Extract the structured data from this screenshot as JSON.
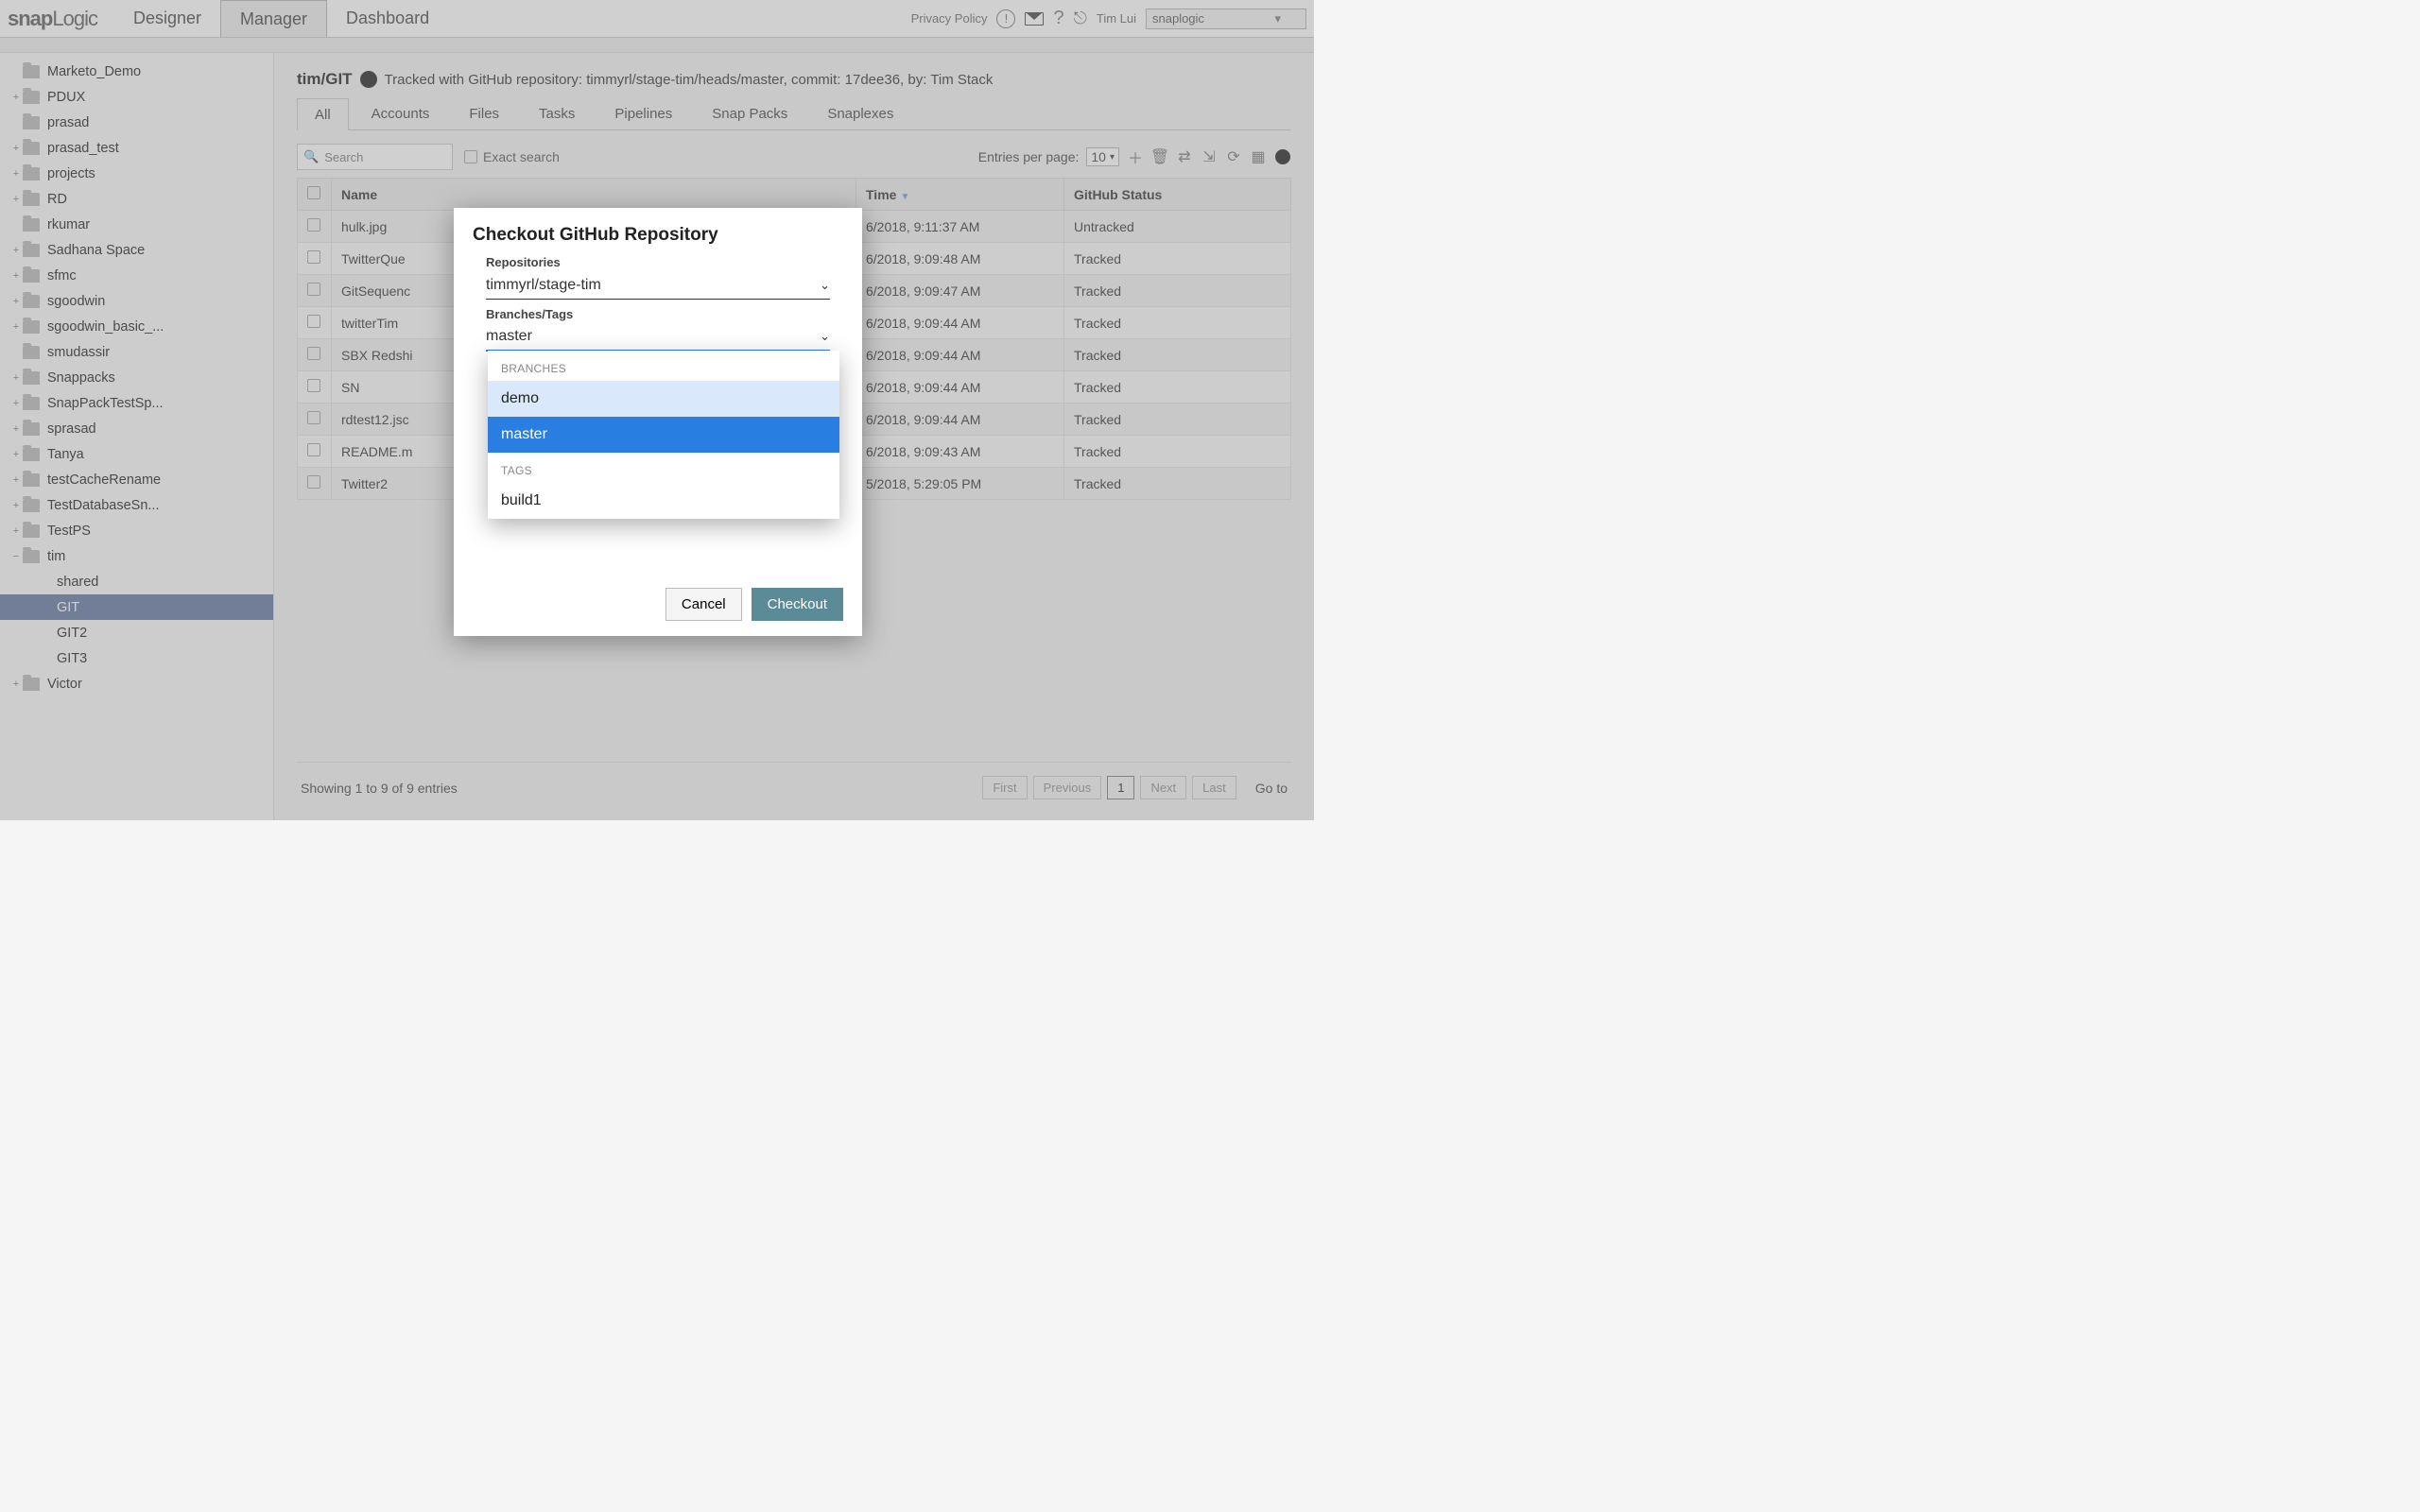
{
  "brand": {
    "a": "snap",
    "b": "Logic"
  },
  "top_tabs": [
    "Designer",
    "Manager",
    "Dashboard"
  ],
  "top": {
    "privacy": "Privacy Policy",
    "user": "Tim Lui",
    "org": "snaplogic"
  },
  "sidebar": {
    "items": [
      {
        "name": "Marketo_Demo",
        "exp": ""
      },
      {
        "name": "PDUX",
        "exp": "+"
      },
      {
        "name": "prasad",
        "exp": ""
      },
      {
        "name": "prasad_test",
        "exp": "+"
      },
      {
        "name": "projects",
        "exp": "+"
      },
      {
        "name": "RD",
        "exp": "+"
      },
      {
        "name": "rkumar",
        "exp": ""
      },
      {
        "name": "Sadhana Space",
        "exp": "+"
      },
      {
        "name": "sfmc",
        "exp": "+"
      },
      {
        "name": "sgoodwin",
        "exp": "+"
      },
      {
        "name": "sgoodwin_basic_...",
        "exp": "+"
      },
      {
        "name": "smudassir",
        "exp": ""
      },
      {
        "name": "Snappacks",
        "exp": "+"
      },
      {
        "name": "SnapPackTestSp...",
        "exp": "+"
      },
      {
        "name": "sprasad",
        "exp": "+"
      },
      {
        "name": "Tanya",
        "exp": "+"
      },
      {
        "name": "testCacheRename",
        "exp": "+"
      },
      {
        "name": "TestDatabaseSn...",
        "exp": "+"
      },
      {
        "name": "TestPS",
        "exp": "+"
      },
      {
        "name": "tim",
        "exp": "−",
        "children": [
          "shared",
          "GIT",
          "GIT2",
          "GIT3"
        ]
      },
      {
        "name": "Victor",
        "exp": "+"
      }
    ],
    "selected_child": "GIT"
  },
  "breadcrumb": {
    "path": "tim/GIT",
    "tracked": "Tracked with GitHub repository: timmyrl/stage-tim/heads/master, commit: 17dee36, by: Tim Stack"
  },
  "content_tabs": [
    "All",
    "Accounts",
    "Files",
    "Tasks",
    "Pipelines",
    "Snap Packs",
    "Snaplexes"
  ],
  "toolbar": {
    "search_ph": "Search",
    "exact": "Exact search",
    "epp_label": "Entries per page:",
    "epp_value": "10"
  },
  "columns": [
    "",
    "Name",
    "Time",
    "GitHub Status"
  ],
  "rows": [
    {
      "name": "hulk.jpg",
      "time": "6/2018, 9:11:37 AM",
      "status": "Untracked"
    },
    {
      "name": "TwitterQue",
      "time": "6/2018, 9:09:48 AM",
      "status": "Tracked"
    },
    {
      "name": "GitSequenc",
      "time": "6/2018, 9:09:47 AM",
      "status": "Tracked"
    },
    {
      "name": "twitterTim",
      "time": "6/2018, 9:09:44 AM",
      "status": "Tracked"
    },
    {
      "name": "SBX Redshi",
      "time": "6/2018, 9:09:44 AM",
      "status": "Tracked"
    },
    {
      "name": "SN",
      "time": "6/2018, 9:09:44 AM",
      "status": "Tracked"
    },
    {
      "name": "rdtest12.jsc",
      "time": "6/2018, 9:09:44 AM",
      "status": "Tracked"
    },
    {
      "name": "README.m",
      "time": "6/2018, 9:09:43 AM",
      "status": "Tracked"
    },
    {
      "name": "Twitter2",
      "time": "5/2018, 5:29:05 PM",
      "status": "Tracked"
    }
  ],
  "footer": {
    "showing": "Showing 1 to 9 of 9 entries",
    "goto": "Go to",
    "first": "First",
    "prev": "Previous",
    "page": "1",
    "next": "Next",
    "last": "Last"
  },
  "modal": {
    "title": "Checkout GitHub Repository",
    "repo_label": "Repositories",
    "repo_value": "timmyrl/stage-tim",
    "branch_label": "Branches/Tags",
    "branch_value": "master",
    "cancel": "Cancel",
    "checkout": "Checkout",
    "dd_sec1": "BRANCHES",
    "dd_sec2": "TAGS",
    "branches": [
      "demo",
      "master"
    ],
    "tags": [
      "build1"
    ]
  }
}
